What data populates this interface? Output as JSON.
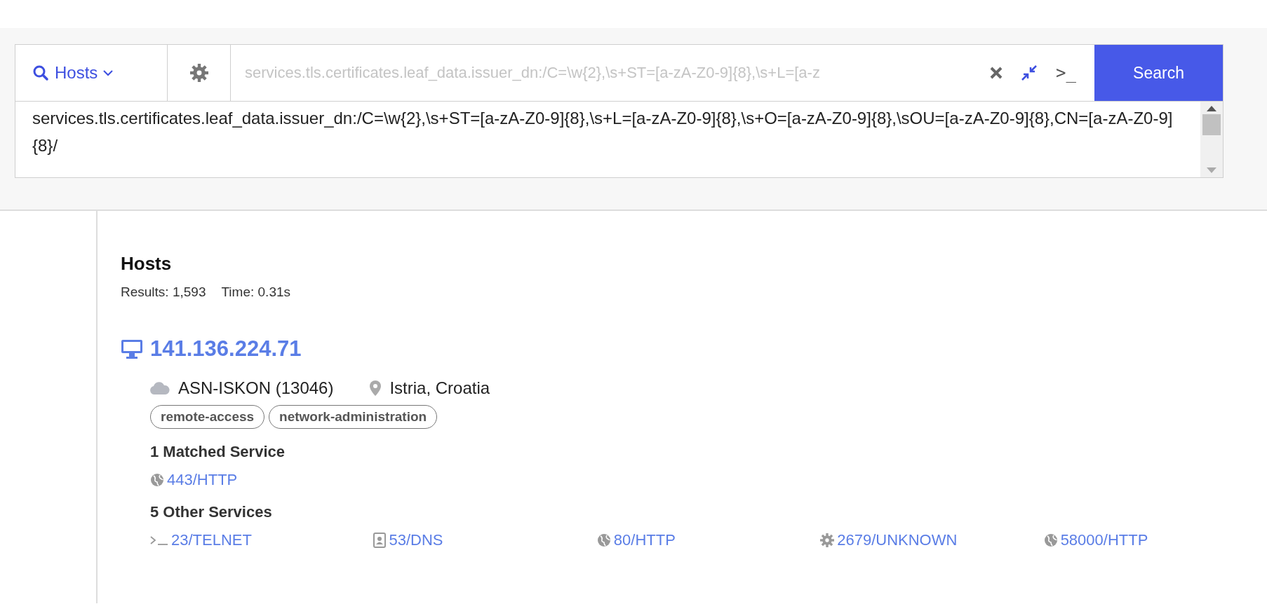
{
  "search_bar": {
    "scope": "Hosts",
    "placeholder": "services.tls.certificates.leaf_data.issuer_dn:/C=\\w{2},\\s+ST=[a-zA-Z0-9]{8},\\s+L=[a-z",
    "terminal_label": ">_",
    "button": "Search",
    "query": "services.tls.certificates.leaf_data.issuer_dn:/C=\\w{2},\\s+ST=[a-zA-Z0-9]{8},\\s+L=[a-zA-Z0-9]{8},\\s+O=[a-zA-Z0-9]{8},\\sOU=[a-zA-Z0-9]{8},CN=[a-zA-Z0-9]{8}/"
  },
  "results": {
    "title": "Hosts",
    "count": "Results: 1,593",
    "time": "Time: 0.31s",
    "hosts": [
      {
        "ip": "141.136.224.71",
        "asn": "ASN-ISKON (13046)",
        "location": "Istria, Croatia",
        "tags": [
          "remote-access",
          "network-administration"
        ],
        "matched_heading": "1 Matched Service",
        "matched": [
          {
            "kind": "globe",
            "label": "443/HTTP"
          }
        ],
        "other_heading": "5 Other Services",
        "other": [
          {
            "kind": "terminal",
            "label": "23/TELNET"
          },
          {
            "kind": "card",
            "label": "53/DNS"
          },
          {
            "kind": "globe",
            "label": "80/HTTP"
          },
          {
            "kind": "gear",
            "label": "2679/UNKNOWN"
          },
          {
            "kind": "globe",
            "label": "58000/HTTP"
          }
        ]
      }
    ]
  }
}
